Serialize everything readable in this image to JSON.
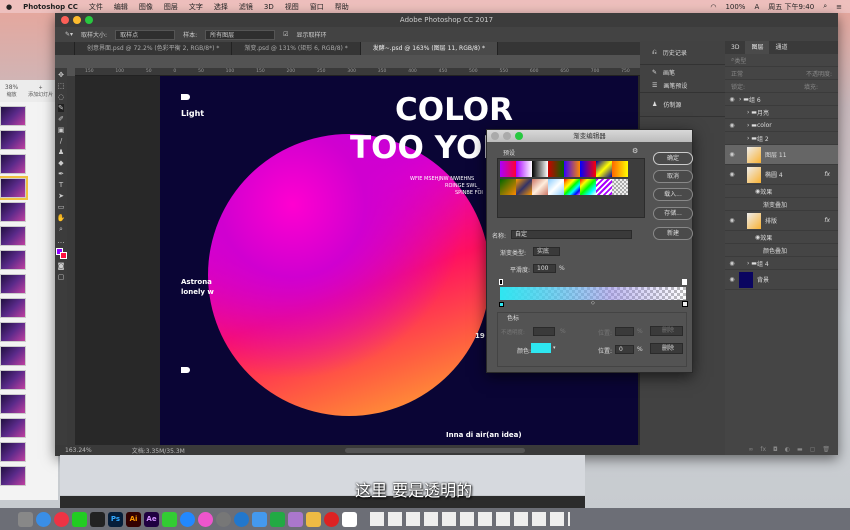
{
  "menubar": {
    "app": "Photoshop CC",
    "items": [
      "文件",
      "编辑",
      "图像",
      "图层",
      "文字",
      "选择",
      "滤镜",
      "3D",
      "视图",
      "窗口",
      "帮助"
    ],
    "battery": "100%",
    "clock": "周五 下午9:40",
    "input": "A"
  },
  "keynote": {
    "zoom": "38%",
    "zoom_label": "缩放",
    "add_label": "添加幻灯片"
  },
  "window": {
    "title": "Adobe Photoshop CC 2017"
  },
  "options": {
    "sample_size_label": "取样大小:",
    "sample_size": "取样点",
    "sample_label": "样本:",
    "sample": "所有图层",
    "show_ring": "显示取样环"
  },
  "tabs": [
    {
      "label": "创意界面.psd @ 72.2% (色彩平衡 2, RGB/8*) *"
    },
    {
      "label": "渐变.psd @ 131% (矩形 6, RGB/8) *"
    },
    {
      "label": "发酵~.psd @ 163% (图层 11, RGB/8) *"
    }
  ],
  "ruler_ticks": [
    "150",
    "100",
    "50",
    "0",
    "50",
    "100",
    "150",
    "200",
    "250",
    "300",
    "350",
    "400",
    "450",
    "500",
    "550",
    "600",
    "650",
    "700",
    "750"
  ],
  "canvas": {
    "light": "Light",
    "title1": "COLOR",
    "title2": "TOO YONG",
    "small1": "WFIE MSEHJNW NWIEHNS",
    "small2": "ROINGE SWL_",
    "small3": "SPINBE FOI",
    "astro1": "Astrona",
    "astro2": "lonely w",
    "year": "19",
    "footer": "Inna di air(an idea)"
  },
  "status": {
    "zoom": "163.24%",
    "doc": "文档:3.35M/35.3M"
  },
  "midpanel": {
    "items": [
      "历史记录",
      "画笔",
      "画笔预设",
      "仿制源"
    ]
  },
  "layers": {
    "tabs": [
      "3D",
      "图层",
      "通道"
    ],
    "kind": "类型",
    "blend": "正常",
    "opacity_label": "不透明度:",
    "lock_label": "锁定:",
    "fill_label": "填充:",
    "rows": [
      {
        "name": "组 6",
        "type": "group",
        "indent": 0,
        "eye": true
      },
      {
        "name": "月亮",
        "type": "group",
        "indent": 1,
        "eye": false
      },
      {
        "name": "color",
        "type": "group",
        "indent": 1,
        "eye": true
      },
      {
        "name": "组 2",
        "type": "group",
        "indent": 1,
        "eye": false
      },
      {
        "name": "图层 11",
        "type": "layer",
        "indent": 1,
        "eye": true,
        "selected": true
      },
      {
        "name": "椭圆 4",
        "type": "layer",
        "indent": 1,
        "eye": true,
        "fx": "fx"
      },
      {
        "name": "效果",
        "type": "effect",
        "indent": 2,
        "eye": false
      },
      {
        "name": "渐变叠加",
        "type": "effect",
        "indent": 3,
        "eye": false
      },
      {
        "name": "排版",
        "type": "layer",
        "indent": 1,
        "eye": true,
        "fx": "fx"
      },
      {
        "name": "效果",
        "type": "effect",
        "indent": 2,
        "eye": false
      },
      {
        "name": "颜色叠加",
        "type": "effect",
        "indent": 3,
        "eye": false
      },
      {
        "name": "组 4",
        "type": "group",
        "indent": 1,
        "eye": true
      },
      {
        "name": "背景",
        "type": "layer",
        "indent": 0,
        "eye": true
      }
    ]
  },
  "dialog": {
    "title": "渐变编辑器",
    "presets_label": "预设",
    "ok": "确定",
    "cancel": "取消",
    "load": "载入...",
    "save": "存储...",
    "new": "新建",
    "name_label": "名称:",
    "name_value": "自定",
    "type_label": "渐变类型:",
    "type_value": "实底",
    "smooth_label": "平滑度:",
    "smooth_value": "100",
    "percent": "%",
    "stops_label": "色标",
    "opacity_label": "不透明度:",
    "location_label": "位置:",
    "delete": "删除",
    "color_label": "颜色:",
    "location_value": "0",
    "stop_color": "#2ee6f0"
  },
  "subtitle": "这里 要是透明的",
  "dock": {
    "items": [
      "Ps",
      "Ai",
      "Ae"
    ]
  }
}
